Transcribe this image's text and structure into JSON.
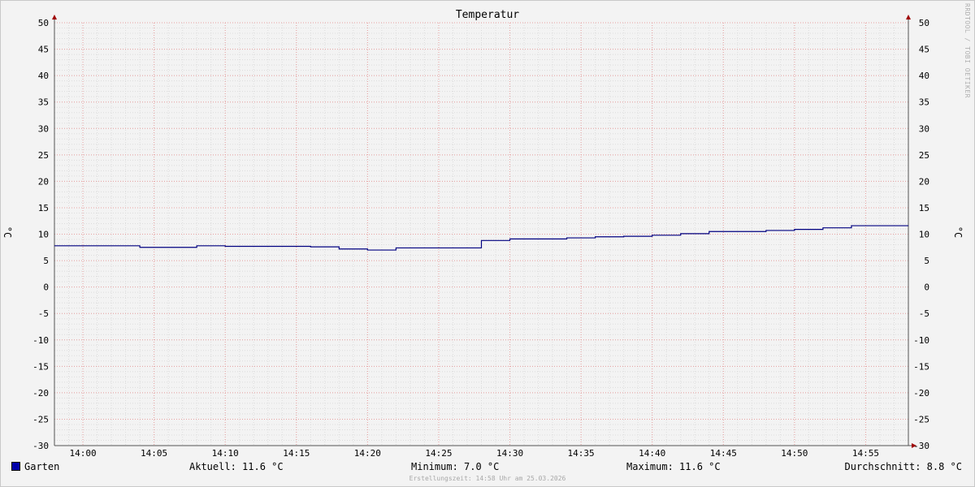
{
  "chart_data": {
    "type": "line",
    "title": "Temperatur",
    "ylabel": "°C",
    "ylim": [
      -30,
      50
    ],
    "yticks": [
      50,
      45,
      40,
      35,
      30,
      25,
      20,
      15,
      10,
      5,
      0,
      -5,
      -10,
      -15,
      -20,
      -25,
      -30
    ],
    "xticks": [
      "14:00",
      "14:05",
      "14:10",
      "14:15",
      "14:20",
      "14:25",
      "14:30",
      "14:35",
      "14:40",
      "14:45",
      "14:50",
      "14:55"
    ],
    "xlim": [
      "13:58",
      "14:58"
    ],
    "grid": true,
    "series": [
      {
        "name": "Garten",
        "color": "#000080",
        "step": true,
        "points": [
          [
            "13:58",
            7.8
          ],
          [
            "14:04",
            7.5
          ],
          [
            "14:08",
            7.8
          ],
          [
            "14:10",
            7.7
          ],
          [
            "14:16",
            7.6
          ],
          [
            "14:18",
            7.2
          ],
          [
            "14:20",
            7.0
          ],
          [
            "14:22",
            7.4
          ],
          [
            "14:28",
            8.8
          ],
          [
            "14:30",
            9.1
          ],
          [
            "14:34",
            9.3
          ],
          [
            "14:36",
            9.5
          ],
          [
            "14:38",
            9.6
          ],
          [
            "14:40",
            9.8
          ],
          [
            "14:42",
            10.1
          ],
          [
            "14:44",
            10.5
          ],
          [
            "14:48",
            10.7
          ],
          [
            "14:50",
            10.9
          ],
          [
            "14:52",
            11.2
          ],
          [
            "14:54",
            11.6
          ],
          [
            "14:58",
            11.6
          ]
        ]
      }
    ]
  },
  "legend": {
    "series_name": "Garten",
    "current": "Aktuell: 11.6 °C",
    "minimum": "Minimum: 7.0 °C",
    "maximum": "Maximum: 11.6 °C",
    "average": "Durchschnitt: 8.8 °C"
  },
  "watermark": "RRDTOOL / TOBI OETIKER",
  "footer": "Erstellungszeit: 14:58 Uhr am 25.03.2026"
}
